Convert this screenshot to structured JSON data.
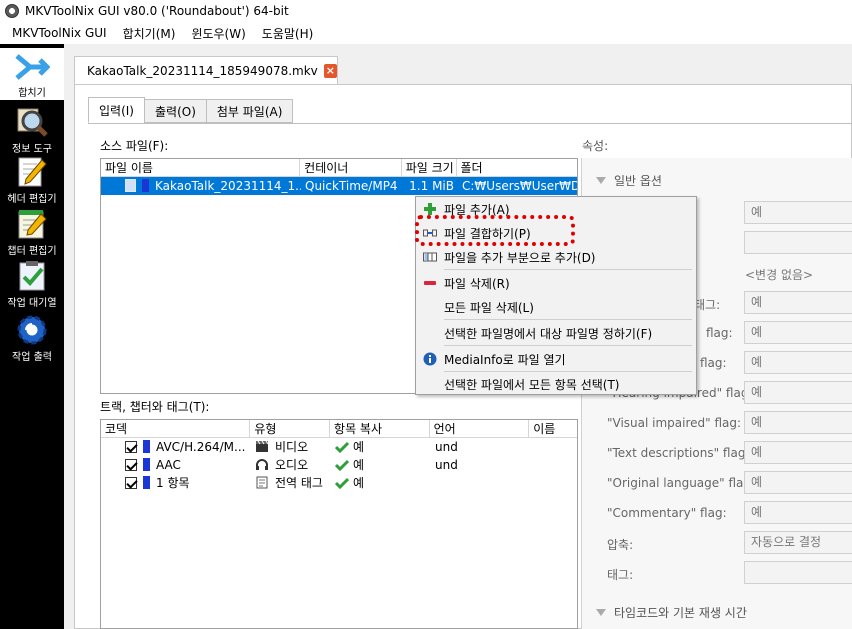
{
  "window": {
    "title": "MKVToolNix GUI v80.0 ('Roundabout') 64-bit"
  },
  "menu": [
    "MKVToolNix GUI",
    "합치기(M)",
    "윈도우(W)",
    "도움말(H)"
  ],
  "sidebar": [
    {
      "label": "합치기",
      "icon": "merge-arrow-icon"
    },
    {
      "label": "정보 도구",
      "icon": "magnifier-icon"
    },
    {
      "label": "헤더 편집기",
      "icon": "pencil-icon"
    },
    {
      "label": "챕터 편집기",
      "icon": "notepad-icon"
    },
    {
      "label": "작업 대기열",
      "icon": "checklist-icon"
    },
    {
      "label": "작업 출력",
      "icon": "gear-icon"
    }
  ],
  "doc_tab": {
    "label": "KakaoTalk_20231114_185949078.mkv",
    "close": "×"
  },
  "subtabs": [
    "입력(I)",
    "출력(O)",
    "첨부 파일(A)"
  ],
  "source_files": {
    "label": "소스 파일(F):",
    "columns": [
      "파일 이름",
      "컨테이너",
      "파일 크기",
      "폴더"
    ],
    "rows": [
      {
        "name": "KakaoTalk_20231114_1...",
        "container": "QuickTime/MP4",
        "size": "1.1 MiB",
        "folder": "C:₩Users₩User₩D..."
      }
    ]
  },
  "tracks": {
    "label": "트랙, 챕터와 태그(T):",
    "columns": [
      "코덱",
      "유형",
      "항목 복사",
      "언어",
      "이름"
    ],
    "rows": [
      {
        "codec": "AVC/H.264/M...",
        "type": "비디오",
        "type_icon": "clapper-icon",
        "copy": "예",
        "lang": "und"
      },
      {
        "codec": "AAC",
        "type": "오디오",
        "type_icon": "headphones-icon",
        "copy": "예",
        "lang": "und"
      },
      {
        "codec": "1 항목",
        "type": "전역 태그",
        "type_icon": "tag-doc-icon",
        "copy": "예",
        "lang": ""
      }
    ]
  },
  "properties": {
    "label": "속성:",
    "section_general": "일반 옵션",
    "no_change": "<변경 없음>",
    "rows": [
      {
        "label": "",
        "value": "예"
      },
      {
        "label": "",
        "value": ""
      },
      {
        "label": "태그:",
        "value": "예"
      },
      {
        "label": "flag:",
        "value": "예"
      },
      {
        "label": "flag:",
        "value": "예"
      },
      {
        "label": "\"Hearing impaired\" flag:",
        "value": "예"
      },
      {
        "label": "\"Visual impaired\" flag:",
        "value": "예"
      },
      {
        "label": "\"Text descriptions\" flag:",
        "value": "예"
      },
      {
        "label": "\"Original language\" flag:",
        "value": "예"
      },
      {
        "label": "\"Commentary\" flag:",
        "value": "예"
      },
      {
        "label": "압축:",
        "value": "자동으로 결정"
      },
      {
        "label": "태그:",
        "value": ""
      }
    ],
    "section_timecode": "타임코드와 기본 재생 시간"
  },
  "context_menu": [
    {
      "label": "파일 추가(A)",
      "icon": "plus-icon"
    },
    {
      "label": "파일 결합하기(P)",
      "icon": "join-icon"
    },
    {
      "label": "파일을 추가 부분으로 추가(D)",
      "icon": "append-icon"
    },
    {
      "label": "파일 삭제(R)",
      "icon": "minus-icon"
    },
    {
      "label": "모든 파일 삭제(L)",
      "icon": ""
    },
    {
      "label": "선택한 파일명에서 대상 파일명 정하기(F)",
      "icon": ""
    },
    {
      "label": "MediaInfo로 파일 열기",
      "icon": "info-icon"
    },
    {
      "label": "선택한 파일에서 모든 항목 선택(T)",
      "icon": ""
    }
  ],
  "colors": {
    "accent": "#0078d7",
    "highlight": "#e00000",
    "sidebar": "#000000"
  }
}
